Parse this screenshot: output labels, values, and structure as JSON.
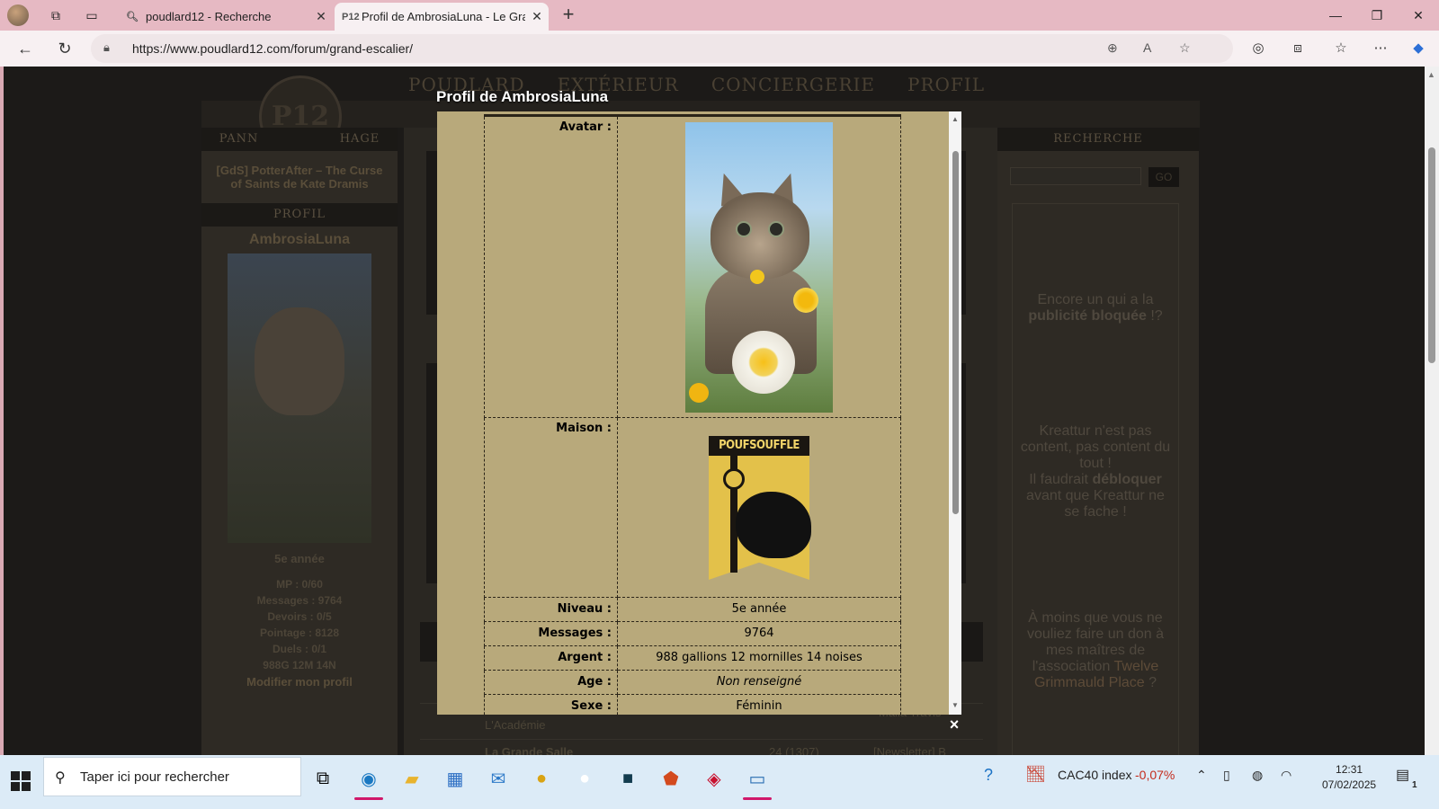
{
  "browser": {
    "tabs": [
      {
        "title": "poudlard12 - Recherche",
        "favicon": "search-icon"
      },
      {
        "title": "Profil de AmbrosiaLuna - Le Grand",
        "favicon": "P12"
      }
    ],
    "url": "https://www.poudlard12.com/forum/grand-escalier/"
  },
  "site": {
    "menu": [
      "POUDLARD",
      "EXTÉRIEUR",
      "CONCIERGERIE",
      "PROFIL"
    ],
    "logo": "P12",
    "left": {
      "panel_head": "PANN",
      "panel_head2": "HAGE",
      "announcement": "[GdS] PotterAfter – The Curse of Saints de Kate Dramis",
      "profile_head": "PROFIL",
      "username": "AmbrosiaLuna",
      "year": "5e année",
      "mp": "MP : 0/60",
      "messages": "Messages : 9764",
      "devoirs": "Devoirs : 0/5",
      "pointage": "Pointage : 8128",
      "duels": "Duels : 0/1",
      "money": "988G 12M 14N",
      "edit_link": "Modifier mon profil"
    },
    "right": {
      "search_head": "RECHERCHE",
      "go": "GO",
      "ad1_a": "Encore un qui a la",
      "ad1_b": "publicité bloquée",
      "ad1_c": " !?",
      "ad2_a": "Kreattur n'est pas content, pas content du tout !",
      "ad2_b": "Il faudrait",
      "ad2_c": "débloquer",
      "ad2_d": "avant que Kreattur ne se fache !",
      "ad3_a": "À moins que vous ne vouliez faire un don à mes maîtres de l'association",
      "ad3_link": "Twelve Grimmauld Place",
      "ad3_end": " ?"
    },
    "mid": {
      "row1_left": "L'Académie",
      "row1_right": "Malia Travis",
      "row2_left": "La Grande Salle",
      "row2_mid": "24 (1307)",
      "row2_right": "[Newsletter] B"
    }
  },
  "modal": {
    "title": "Profil de AmbrosiaLuna",
    "close": "×",
    "fields": {
      "avatar_label": "Avatar :",
      "house_label": "Maison :",
      "house_name": "POUFSOUFFLE",
      "level_label": "Niveau :",
      "level_value": "5e année",
      "messages_label": "Messages :",
      "messages_value": "9764",
      "money_label": "Argent :",
      "money_value": "988 gallions 12 mornilles 14 noises",
      "age_label": "Age :",
      "age_value": "Non renseigné",
      "sex_label": "Sexe :",
      "sex_value": "Féminin"
    }
  },
  "taskbar": {
    "search_placeholder": "Taper ici pour rechercher",
    "stock_name": "CAC40 index",
    "stock_change": "-0,07%",
    "time": "12:31",
    "date": "07/02/2025",
    "notif_count": "1"
  }
}
